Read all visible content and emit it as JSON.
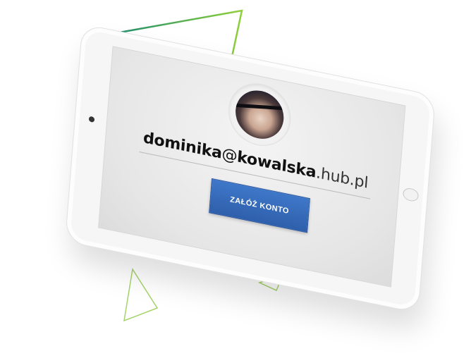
{
  "profile": {
    "email_user": "dominika",
    "email_at": "@",
    "email_name": "kowalska",
    "email_domain": ".hub.pl"
  },
  "actions": {
    "create_account_label": "ZAŁÓŻ KONTO"
  },
  "colors": {
    "accent": "#2e5fab",
    "decoration_green": "#6fbf3a",
    "decoration_teal": "#2aa37a"
  }
}
